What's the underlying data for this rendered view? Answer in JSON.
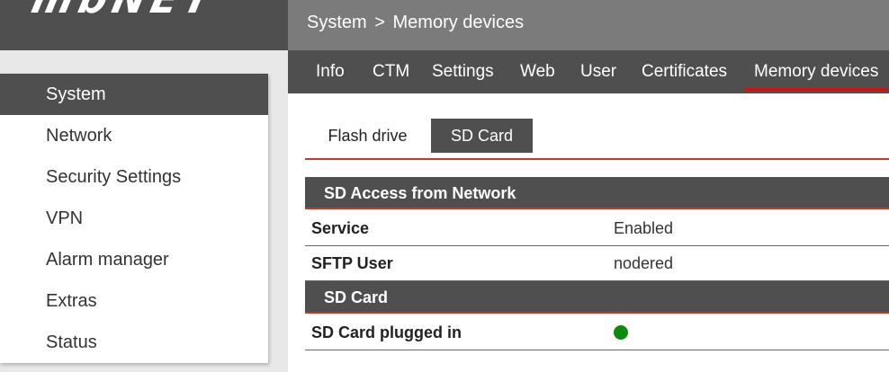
{
  "logo": {
    "text": "mbNET"
  },
  "breadcrumb": {
    "root": "System",
    "separator": ">",
    "current": "Memory devices"
  },
  "tabs": [
    {
      "label": "Info"
    },
    {
      "label": "CTM"
    },
    {
      "label": "Settings"
    },
    {
      "label": "Web"
    },
    {
      "label": "User"
    },
    {
      "label": "Certificates"
    },
    {
      "label": "Memory devices",
      "active": true
    }
  ],
  "sidebar": {
    "items": [
      {
        "label": "System",
        "active": true
      },
      {
        "label": "Network"
      },
      {
        "label": "Security Settings"
      },
      {
        "label": "VPN"
      },
      {
        "label": "Alarm manager"
      },
      {
        "label": "Extras"
      },
      {
        "label": "Status"
      }
    ]
  },
  "subtabs": [
    {
      "label": "Flash drive"
    },
    {
      "label": "SD Card",
      "active": true
    }
  ],
  "sections": {
    "access": {
      "title": "SD Access from Network",
      "rows": [
        {
          "label": "Service",
          "value": "Enabled"
        },
        {
          "label": "SFTP User",
          "value": "nodered"
        }
      ]
    },
    "sdcard": {
      "title": "SD Card",
      "rows": [
        {
          "label": "SD Card plugged in",
          "status": "ok",
          "status_color": "#0b8a0b"
        }
      ]
    }
  },
  "colors": {
    "accent": "#cc1111",
    "dark": "#4f4f4f",
    "header": "#7b7b7b",
    "status_ok": "#0b8a0b"
  }
}
